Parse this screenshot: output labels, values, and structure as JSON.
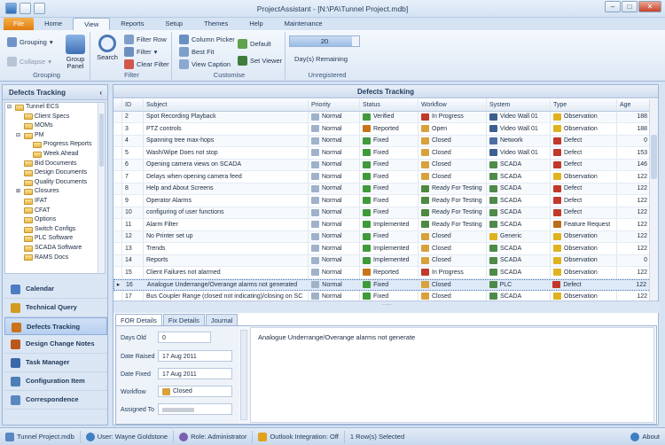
{
  "app": {
    "title": "ProjectAssistant - [N:\\PA\\Tunnel Project.mdb]"
  },
  "tabs": [
    "File",
    "Home",
    "View",
    "Reports",
    "Setup",
    "Themes",
    "Help",
    "Maintenance"
  ],
  "ribbon": {
    "grouping": {
      "label": "Grouping",
      "grouping_btn": "Grouping",
      "collapse_btn": "Collapse",
      "group_panel_btn": "Group Panel"
    },
    "filter": {
      "label": "Filter",
      "search_btn": "Search",
      "filter_row": "Filter Row",
      "filter": "Filter",
      "clear_filter": "Clear Filter"
    },
    "customise": {
      "label": "Customise",
      "column_picker": "Column Picker",
      "best_fit": "Best Fit",
      "view_caption": "View Caption",
      "default": "Default",
      "set_viewer": "Set Viewer"
    },
    "unregistered": {
      "label": "Unregistered",
      "days_value": "20",
      "days_label": "Day(s) Remaining",
      "progress_fraction": 0.9
    }
  },
  "sidebar": {
    "title": "Defects Tracking",
    "tree": [
      {
        "label": "Tunnel ECS",
        "level": 0,
        "toggle": "⊟"
      },
      {
        "label": "Client Specs",
        "level": 1,
        "toggle": ""
      },
      {
        "label": "MOMs",
        "level": 1,
        "toggle": ""
      },
      {
        "label": "PM",
        "level": 1,
        "toggle": "⊟"
      },
      {
        "label": "Progress Reports",
        "level": 2,
        "toggle": ""
      },
      {
        "label": "Week Ahead",
        "level": 2,
        "toggle": ""
      },
      {
        "label": "Bid Documents",
        "level": 1,
        "toggle": ""
      },
      {
        "label": "Design Documents",
        "level": 1,
        "toggle": ""
      },
      {
        "label": "Quality Documents",
        "level": 1,
        "toggle": ""
      },
      {
        "label": "Closures",
        "level": 1,
        "toggle": "⊞"
      },
      {
        "label": "IFAT",
        "level": 1,
        "toggle": ""
      },
      {
        "label": "CFAT",
        "level": 1,
        "toggle": ""
      },
      {
        "label": "Options",
        "level": 1,
        "toggle": ""
      },
      {
        "label": "Switch Configs",
        "level": 1,
        "toggle": ""
      },
      {
        "label": "PLC Software",
        "level": 1,
        "toggle": ""
      },
      {
        "label": "SCADA Software",
        "level": 1,
        "toggle": ""
      },
      {
        "label": "RAMS Docs",
        "level": 1,
        "toggle": ""
      }
    ],
    "nav": [
      {
        "label": "Calendar",
        "icon": "calendar-icon",
        "color": "#4d7cc4"
      },
      {
        "label": "Technical Query",
        "icon": "query-icon",
        "color": "#d19b1f"
      },
      {
        "label": "Defects Tracking",
        "icon": "bug-icon",
        "color": "#c9731a",
        "active": true
      },
      {
        "label": "Design Change Notes",
        "icon": "design-change-icon",
        "color": "#b9581a"
      },
      {
        "label": "Task Manager",
        "icon": "task-icon",
        "color": "#3a68a8"
      },
      {
        "label": "Configuration Item",
        "icon": "config-icon",
        "color": "#4c7eb7"
      },
      {
        "label": "Correspondence",
        "icon": "mail-icon",
        "color": "#5a87c2"
      }
    ]
  },
  "grid": {
    "title": "Defects Tracking",
    "columns": [
      "ID",
      "Subject",
      "Priority",
      "Status",
      "Workflow",
      "System",
      "Type",
      "Age"
    ],
    "rows": [
      {
        "id": "2",
        "subject": "Spot Recording Playback",
        "priority": "Normal",
        "status": "Verified",
        "workflow": "In Progress",
        "system": "Video Wall 01",
        "type": "Observation",
        "age": "188"
      },
      {
        "id": "3",
        "subject": "PTZ controls",
        "priority": "Normal",
        "status": "Reported",
        "workflow": "Open",
        "system": "Video Wall 01",
        "type": "Observation",
        "age": "188"
      },
      {
        "id": "4",
        "subject": "Spanning tree max-hops",
        "priority": "Normal",
        "status": "Fixed",
        "workflow": "Closed",
        "system": "Network",
        "type": "Defect",
        "age": "0"
      },
      {
        "id": "5",
        "subject": "Wash/Wipe Does not stop",
        "priority": "Normal",
        "status": "Fixed",
        "workflow": "Closed",
        "system": "Video Wall 01",
        "type": "Defect",
        "age": "153"
      },
      {
        "id": "6",
        "subject": "Opening camera views on SCADA",
        "priority": "Normal",
        "status": "Fixed",
        "workflow": "Closed",
        "system": "SCADA",
        "type": "Defect",
        "age": "146"
      },
      {
        "id": "7",
        "subject": "Delays when opening camera feed",
        "priority": "Normal",
        "status": "Fixed",
        "workflow": "Closed",
        "system": "SCADA",
        "type": "Observation",
        "age": "122"
      },
      {
        "id": "8",
        "subject": "Help and About Screens",
        "priority": "Normal",
        "status": "Fixed",
        "workflow": "Ready For Testing",
        "system": "SCADA",
        "type": "Defect",
        "age": "122"
      },
      {
        "id": "9",
        "subject": "Operator Alarms",
        "priority": "Normal",
        "status": "Fixed",
        "workflow": "Ready For Testing",
        "system": "SCADA",
        "type": "Defect",
        "age": "122"
      },
      {
        "id": "10",
        "subject": "configuring of user functions",
        "priority": "Normal",
        "status": "Fixed",
        "workflow": "Ready For Testing",
        "system": "SCADA",
        "type": "Defect",
        "age": "122"
      },
      {
        "id": "11",
        "subject": "Alarm Filter",
        "priority": "Normal",
        "status": "Implemented",
        "workflow": "Ready For Testing",
        "system": "SCADA",
        "type": "Feature Request",
        "age": "122"
      },
      {
        "id": "12",
        "subject": "No Printer set up",
        "priority": "Normal",
        "status": "Fixed",
        "workflow": "Closed",
        "system": "Generic",
        "type": "Observation",
        "age": "122"
      },
      {
        "id": "13",
        "subject": "Trends",
        "priority": "Normal",
        "status": "Implemented",
        "workflow": "Closed",
        "system": "SCADA",
        "type": "Observation",
        "age": "122"
      },
      {
        "id": "14",
        "subject": "Reports",
        "priority": "Normal",
        "status": "Implemented",
        "workflow": "Closed",
        "system": "SCADA",
        "type": "Observation",
        "age": "0"
      },
      {
        "id": "15",
        "subject": "Client Failures not alarmed",
        "priority": "Normal",
        "status": "Reported",
        "workflow": "In Progress",
        "system": "SCADA",
        "type": "Observation",
        "age": "122"
      },
      {
        "id": "16",
        "subject": "Analogue Underrange/Overange alarms not generated",
        "priority": "Normal",
        "status": "Fixed",
        "workflow": "Closed",
        "system": "PLC",
        "type": "Defect",
        "age": "122",
        "selected": true
      },
      {
        "id": "17",
        "subject": "Bus Coupler Range (closed not indicating)/closing on SC",
        "priority": "Normal",
        "status": "Fixed",
        "workflow": "Closed",
        "system": "SCADA",
        "type": "Observation",
        "age": "122"
      }
    ]
  },
  "details": {
    "tabs": [
      "FOR Details",
      "Fix Details",
      "Journal"
    ],
    "days_old_label": "Days Old",
    "days_old": "0",
    "date_raised_label": "Date Raised",
    "date_raised": "17 Aug 2011",
    "date_fixed_label": "Date Fixed",
    "date_fixed": "17 Aug 2011",
    "workflow_label": "Workflow",
    "workflow": "Closed",
    "assigned_label": "Assigned To",
    "assigned": "",
    "description": "Analogue Underrange/Overange alarms not generate"
  },
  "statusbar": {
    "file": "Tunnel Project.mdb",
    "user": "User: Wayne Goldstone",
    "role": "Role: Administrator",
    "outlook": "Outlook Integration: Off",
    "selection": "1 Row(s) Selected",
    "about": "About"
  },
  "colors": {
    "accent": "#e07d10",
    "status_fixed": "#3f9a3a",
    "status_reported": "#c9731a",
    "type_defect": "#c0392b"
  }
}
